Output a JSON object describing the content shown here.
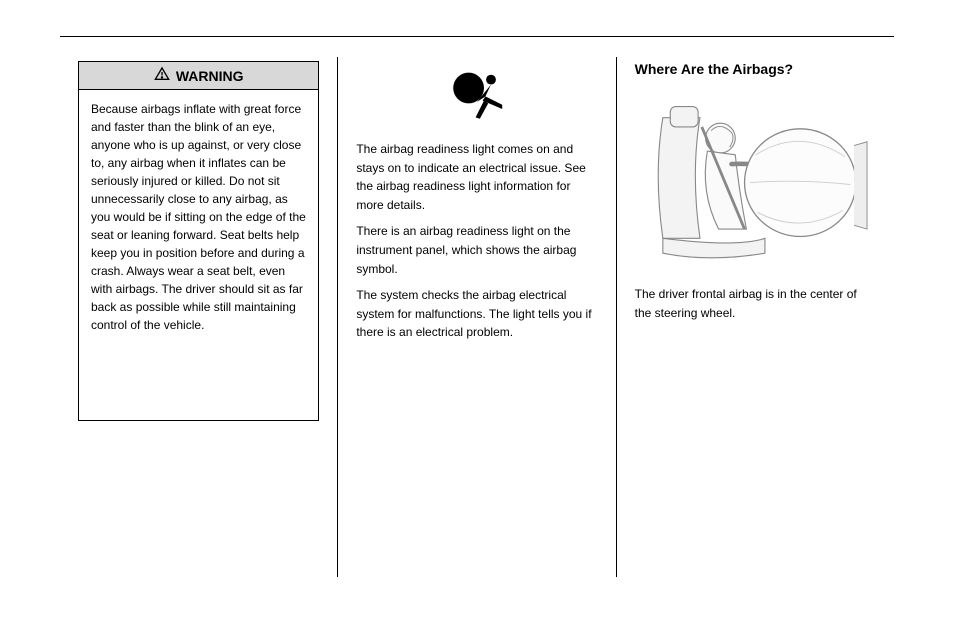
{
  "header": {
    "rule": true
  },
  "col1": {
    "warning": {
      "label": "WARNING",
      "body": "Because airbags inflate with great force and faster than the blink of an eye, anyone who is up against, or very close to, any airbag when it inflates can be seriously injured or killed. Do not sit unnecessarily close to any airbag, as you would be if sitting on the edge of the seat or leaning forward. Seat belts help keep you in position before and during a crash. Always wear a seat belt, even with airbags. The driver should sit as far back as possible while still maintaining control of the vehicle."
    }
  },
  "col2": {
    "icon_name": "airbag-icon",
    "paragraphs": [
      "The airbag readiness light comes on and stays on to indicate an electrical issue. See the airbag readiness light information for more details.",
      "There is an airbag readiness light on the instrument panel, which shows the airbag symbol.",
      "The system checks the airbag electrical system for malfunctions. The light tells you if there is an electrical problem."
    ]
  },
  "col3": {
    "heading": "Where Are the Airbags?",
    "illustration_alt": "Driver with deployed frontal airbag",
    "caption": "The driver frontal airbag is in the center of the steering wheel."
  }
}
